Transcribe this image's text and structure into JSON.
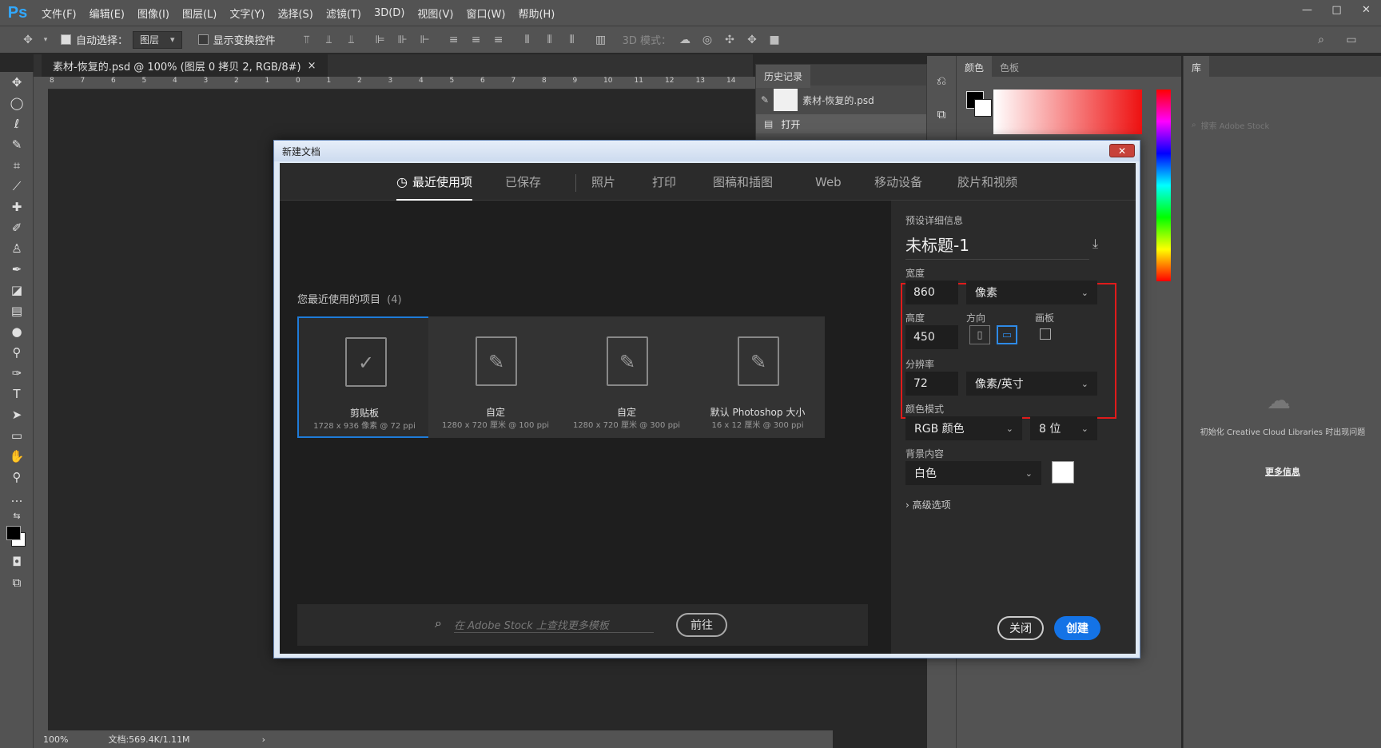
{
  "app": {
    "logo": "Ps"
  },
  "menu": [
    "文件(F)",
    "编辑(E)",
    "图像(I)",
    "图层(L)",
    "文字(Y)",
    "选择(S)",
    "滤镜(T)",
    "3D(D)",
    "视图(V)",
    "窗口(W)",
    "帮助(H)"
  ],
  "window_controls": {
    "minimize": "—",
    "maximize": "□",
    "close": "✕"
  },
  "options": {
    "auto_select_label": "自动选择：",
    "auto_select_value": "图层",
    "show_transform_label": "显示变换控件",
    "mode_3d_label": "3D 模式："
  },
  "document_tab": {
    "title": "素材-恢复的.psd @ 100% (图层 0 拷贝 2, RGB/8#)",
    "close": "×"
  },
  "ruler_top": [
    "8",
    "7",
    "6",
    "5",
    "4",
    "3",
    "2",
    "1",
    "0",
    "1",
    "2",
    "3",
    "4",
    "5",
    "6",
    "7",
    "8",
    "9",
    "10",
    "11",
    "12",
    "13",
    "14"
  ],
  "status": {
    "zoom": "100%",
    "doc": "文档:569.4K/1.11M",
    "arrow": "›"
  },
  "history": {
    "tab": "历史记录",
    "file_name": "素材-恢复的.psd",
    "step": "打开"
  },
  "color_panel": {
    "tab_color": "颜色",
    "tab_swatches": "色板"
  },
  "library": {
    "tab": "库",
    "search_placeholder": "搜索 Adobe Stock",
    "message": "初始化 Creative Cloud Libraries 时出现问题",
    "more_info": "更多信息"
  },
  "dialog": {
    "title": "新建文档",
    "close": "✕",
    "tabs": [
      "最近使用项",
      "已保存",
      "照片",
      "打印",
      "图稿和插图",
      "Web",
      "移动设备",
      "胶片和视频"
    ],
    "recent_title": "您最近使用的项目",
    "recent_count": "(4)",
    "cards": [
      {
        "name": "剪贴板",
        "desc": "1728 x 936 像素 @ 72 ppi"
      },
      {
        "name": "自定",
        "desc": "1280 x 720 厘米 @ 100 ppi"
      },
      {
        "name": "自定",
        "desc": "1280 x 720 厘米 @ 300 ppi"
      },
      {
        "name": "默认 Photoshop 大小",
        "desc": "16 x 12 厘米 @ 300 ppi"
      }
    ],
    "stock_placeholder": "在 Adobe Stock 上查找更多模板",
    "stock_go": "前往",
    "preset": {
      "header": "预设详细信息",
      "name": "未标题-1",
      "width_label": "宽度",
      "width": "860",
      "width_unit": "像素",
      "height_label": "高度",
      "height": "450",
      "orientation_label": "方向",
      "artboard_label": "画板",
      "resolution_label": "分辨率",
      "resolution": "72",
      "resolution_unit": "像素/英寸",
      "color_mode_label": "颜色模式",
      "color_mode": "RGB 颜色",
      "bit_depth": "8 位",
      "background_label": "背景内容",
      "background": "白色",
      "advanced": "高级选项"
    },
    "buttons": {
      "close": "关闭",
      "create": "创建"
    }
  },
  "colors": {
    "accent": "#1473e6",
    "highlight_box": "#e01b1b"
  }
}
